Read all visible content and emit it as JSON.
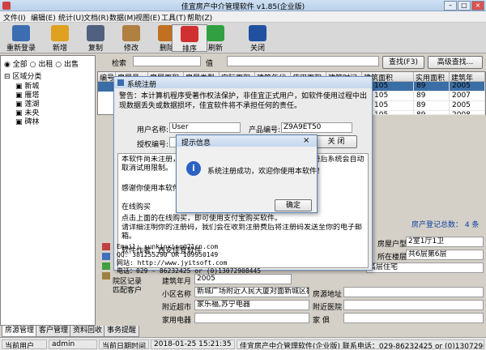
{
  "window": {
    "title": "佳宜房产中介管理软件 v1.85(企业版)",
    "min": "–",
    "max": "□",
    "close": "×"
  },
  "menu": [
    "文件(I)",
    "编辑(E)",
    "统计(U)",
    "文档(R)",
    "数据(M)",
    "视图(E)",
    "工具(T)",
    "帮助(Z)"
  ],
  "toolbar": [
    {
      "label": "重新登录",
      "color": "#3b6db0"
    },
    {
      "label": "新增",
      "color": "#e0a020"
    },
    {
      "label": "复制",
      "color": "#506080"
    },
    {
      "label": "修改",
      "color": "#b08040"
    },
    {
      "label": "删除",
      "color": "#c07020"
    },
    {
      "label": "排序",
      "color": "#d03030"
    },
    {
      "label": "刷新",
      "color": "#30a040"
    },
    {
      "label": "关闭",
      "color": "#2050a0"
    }
  ],
  "left": {
    "radio_all": "全部",
    "radio_rent": "出租",
    "radio_sale": "出售",
    "tree_root": "区域分类",
    "tree_items": [
      "新城",
      "雁塔",
      "莲湖",
      "未央",
      "碑林"
    ]
  },
  "search": {
    "label1": "检索",
    "label2": "值",
    "find_btn": "查找(F3)",
    "adv_btn": "高级查找..."
  },
  "grid": {
    "headers": [
      "编号",
      "房屋号",
      "房屋面积",
      "房屋类型",
      "实际面积",
      "建筑年代",
      "使用面积",
      "建筑时间",
      "建筑面积",
      "实用面积",
      "建筑年"
    ],
    "rows": [
      [
        "105",
        "89",
        "2005"
      ],
      [
        "105",
        "89",
        "2007"
      ],
      [
        "105",
        "89",
        "2005"
      ],
      [
        "105",
        "89",
        "2008"
      ]
    ]
  },
  "reg": {
    "title": "系统注册",
    "warn": "警告：本计算机程序受著作权法保护，非佳宜正式用户，如软件使用过程中出现数据丢失或数据损坏，佳宜软件将不承担任何的责任。",
    "user_label": "用户名称:",
    "user_value": "User",
    "prod_label": "产品编号:",
    "prod_value": "Z9A9ET50",
    "auth_label": "授权编号:",
    "close_btn": "关 闭",
    "body1": "本软件尚未注册，您可以免费试用，但试用期限为45天，注册后系统会自动取消试用限制。",
    "body2": "感谢你使用本软件！",
    "body3": "在线购买",
    "body4": "点击上面的在线购买，即可使用支付宝购买软件。",
    "body5": "请详细注明你的注册码，我们会在收到注册费后将注册码发送至你的电子邮箱。",
    "author_label": "软件作者：西安佳宜软件",
    "email": "Email: sunkinxing@21cn.com",
    "qq": "QQ:    381255290 OR 109950149",
    "web": "网站:   http://www.jyitsoft.com",
    "tel": "电话：029 - 86232425 or (0)13072908445"
  },
  "msgbox": {
    "title": "提示信息",
    "text": "系统注册成功，欢迎你使用本软件！",
    "ok": "确定",
    "close": "×"
  },
  "side": {
    "records": "院区记录",
    "customers": "匹配客户"
  },
  "detail": {
    "count_label": "房产登记总数：",
    "count_value": "4 条",
    "type_label": "房屋户型",
    "type_value": "2室1厅1卫",
    "floor_label": "所在楼层",
    "floor_value": "共6层第6层",
    "decor_value": "高层住宅",
    "year_label": "建筑年月",
    "year_value": "2005",
    "comm_label": "小区名称",
    "comm_value": "新城广场附近人民大厦对面新城区教育局",
    "addr_label": "房源地址",
    "near_label": "附近超市",
    "near_value": "家乐福,苏宁电器",
    "hosp_label": "附近医院",
    "app_label": "家用电器",
    "furn_label": "家  俱"
  },
  "tabs": [
    "房源管理",
    "客户管理",
    "资料回收",
    "事务提醒"
  ],
  "status": {
    "user_label": "当前用户",
    "user_value": "admin",
    "date_label": "当前日期时间",
    "date_value": "2018-01-25 15:21:35",
    "company": "佳宜房产中介管理软件(企业版) 联系电话：029-86232425 or (0)13072908445"
  }
}
